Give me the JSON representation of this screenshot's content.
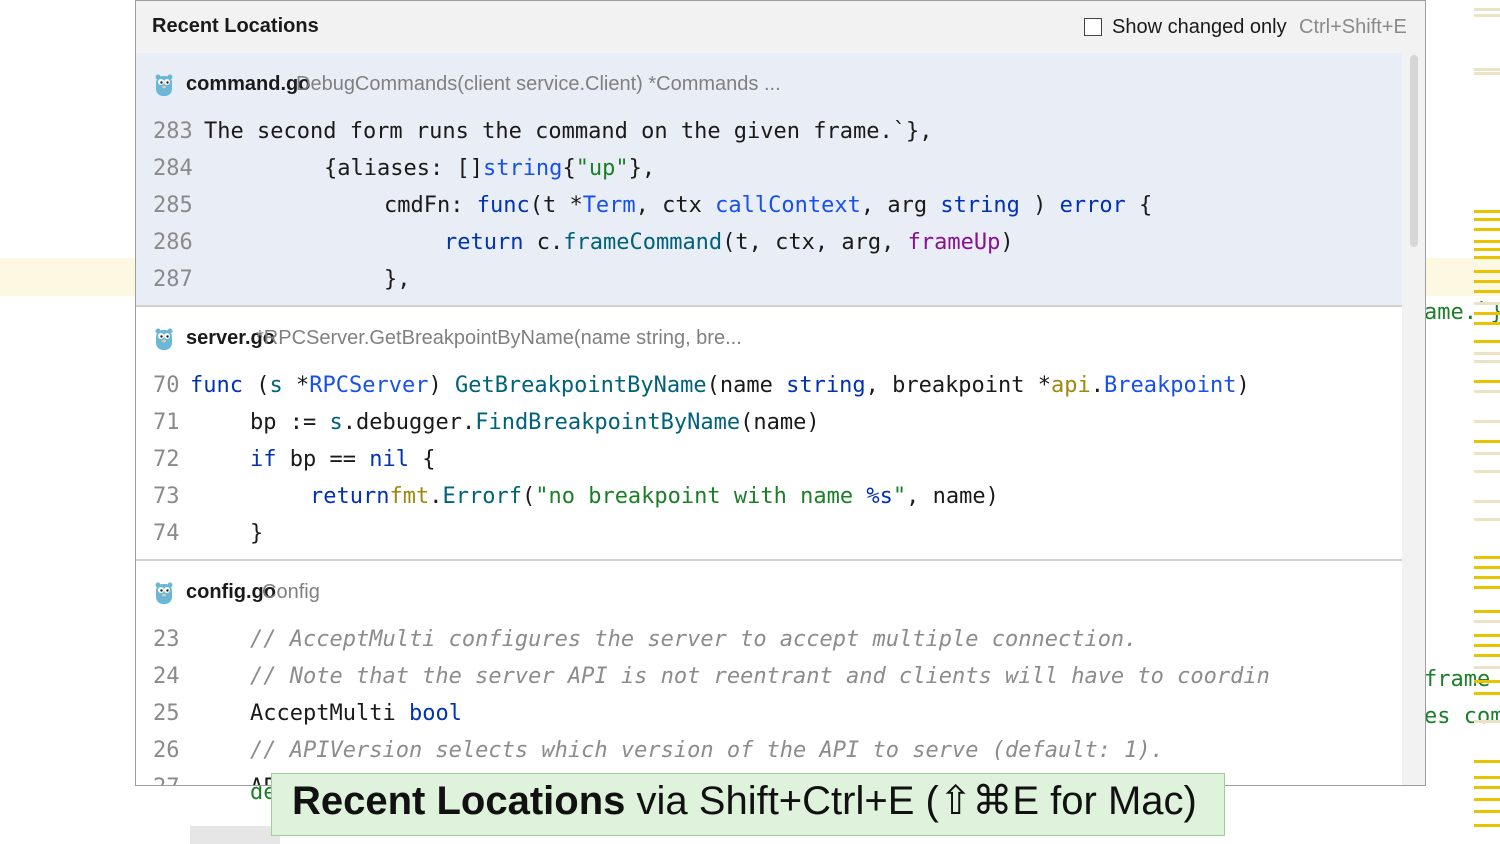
{
  "background": {
    "fragments": [
      "ame.`}",
      "frame",
      "es com",
      "de"
    ]
  },
  "popup": {
    "title": "Recent Locations",
    "show_changed_label": "Show changed only",
    "show_changed_checked": false,
    "show_changed_shortcut": "Ctrl+Shift+E",
    "entries": [
      {
        "file": "command.go",
        "context": "DebugCommands(client service.Client) *Commands ...",
        "selected": true,
        "lines": [
          {
            "num": "283",
            "indent": 0,
            "tokens": [
              [
                "",
                "The second form runs the command on the given frame.`},"
              ]
            ]
          },
          {
            "num": "284",
            "indent": 2,
            "tokens": [
              [
                "",
                "{aliases: []"
              ],
              [
                "t",
                "string"
              ],
              [
                "",
                "{"
              ],
              [
                "s",
                "\"up\""
              ],
              [
                "",
                "},"
              ]
            ]
          },
          {
            "num": "285",
            "indent": 3,
            "tokens": [
              [
                "",
                "cmdFn: "
              ],
              [
                "k",
                "func"
              ],
              [
                "",
                "(t *"
              ],
              [
                "t",
                "Term"
              ],
              [
                "",
                ", ctx "
              ],
              [
                "t",
                "callContext"
              ],
              [
                "",
                ", arg "
              ],
              [
                "k",
                "string"
              ],
              [
                "",
                " ) "
              ],
              [
                "k",
                "error"
              ],
              [
                "",
                " {"
              ]
            ]
          },
          {
            "num": "286",
            "indent": 4,
            "tokens": [
              [
                "k",
                "return"
              ],
              [
                "",
                " c."
              ],
              [
                "fn",
                "frameCommand"
              ],
              [
                "",
                "(t, ctx, arg, "
              ],
              [
                "p",
                "frameUp"
              ],
              [
                "",
                ")"
              ]
            ]
          },
          {
            "num": "287",
            "indent": 3,
            "tokens": [
              [
                "",
                "},"
              ]
            ]
          }
        ]
      },
      {
        "file": "server.go",
        "context": "*RPCServer.GetBreakpointByName(name string, bre...",
        "selected": false,
        "lines": [
          {
            "num": "70",
            "indent": 0,
            "tokens": [
              [
                "k",
                "func"
              ],
              [
                "",
                " ("
              ],
              [
                "fn",
                "s"
              ],
              [
                "",
                " *"
              ],
              [
                "t",
                "RPCServer"
              ],
              [
                "",
                ") "
              ],
              [
                "fn",
                "GetBreakpointByName"
              ],
              [
                "",
                "(name "
              ],
              [
                "k",
                "string"
              ],
              [
                "",
                ", breakpoint *"
              ],
              [
                "pk",
                "api"
              ],
              [
                "",
                "."
              ],
              [
                "t",
                "Breakpoint"
              ],
              [
                "",
                ")"
              ]
            ]
          },
          {
            "num": "71",
            "indent": 1,
            "tokens": [
              [
                "",
                "bp := "
              ],
              [
                "fn",
                "s"
              ],
              [
                "",
                "."
              ],
              [
                "",
                "debugger."
              ],
              [
                "fn",
                "FindBreakpointByName"
              ],
              [
                "",
                "(name)"
              ]
            ]
          },
          {
            "num": "72",
            "indent": 1,
            "tokens": [
              [
                "k",
                "if"
              ],
              [
                "",
                " bp == "
              ],
              [
                "k",
                "nil"
              ],
              [
                "",
                " {"
              ]
            ]
          },
          {
            "num": "73",
            "indent": 2,
            "tokens": [
              [
                "k",
                "return"
              ],
              [
                " ",
                ""
              ],
              [
                "pk",
                "fmt"
              ],
              [
                "",
                "."
              ],
              [
                "fn",
                "Errorf"
              ],
              [
                "",
                "("
              ],
              [
                "s",
                "\"no breakpoint with name "
              ],
              [
                "k",
                "%s"
              ],
              [
                "s",
                "\""
              ],
              [
                "",
                ", name)"
              ]
            ]
          },
          {
            "num": "74",
            "indent": 1,
            "tokens": [
              [
                "",
                "}"
              ]
            ]
          }
        ]
      },
      {
        "file": "config.go",
        "context": "Config",
        "selected": false,
        "lines": [
          {
            "num": "23",
            "indent": 1,
            "tokens": [
              [
                "c",
                "// AcceptMulti configures the server to accept multiple connection."
              ]
            ]
          },
          {
            "num": "24",
            "indent": 1,
            "tokens": [
              [
                "c",
                "// Note that the server API is not reentrant and clients will have to coordin"
              ]
            ]
          },
          {
            "num": "25",
            "indent": 1,
            "tokens": [
              [
                "",
                "AcceptMulti "
              ],
              [
                "k",
                "bool"
              ]
            ]
          },
          {
            "num": "26",
            "indent": 1,
            "tokens": [
              [
                "c",
                "// APIVersion selects which version of the API to serve (default: 1)."
              ]
            ]
          },
          {
            "num": "27",
            "indent": 1,
            "tokens": [
              [
                "",
                "APIVersion "
              ],
              [
                "k",
                "int"
              ]
            ]
          }
        ]
      }
    ]
  },
  "banner": {
    "bold": "Recent Locations",
    "rest": " via Shift+Ctrl+E (⇧⌘E for Mac)"
  }
}
